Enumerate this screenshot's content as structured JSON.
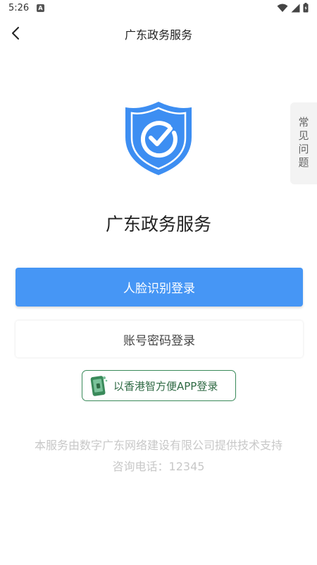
{
  "status_bar": {
    "time": "5:26",
    "notification_letter": "A"
  },
  "nav": {
    "title": "广东政务服务"
  },
  "faq_tab": {
    "label": "常见问题"
  },
  "main": {
    "app_name": "广东政务服务",
    "face_login_label": "人脸识别登录",
    "password_login_label": "账号密码登录",
    "hk_login_label": "以香港智方便APP登录"
  },
  "footer": {
    "support_text": "本服务由数字广东网络建设有限公司提供技术支持",
    "hotline_text": "咨询电话：12345"
  },
  "colors": {
    "primary_blue": "#4696f5",
    "hk_green": "#3a8a5a"
  }
}
